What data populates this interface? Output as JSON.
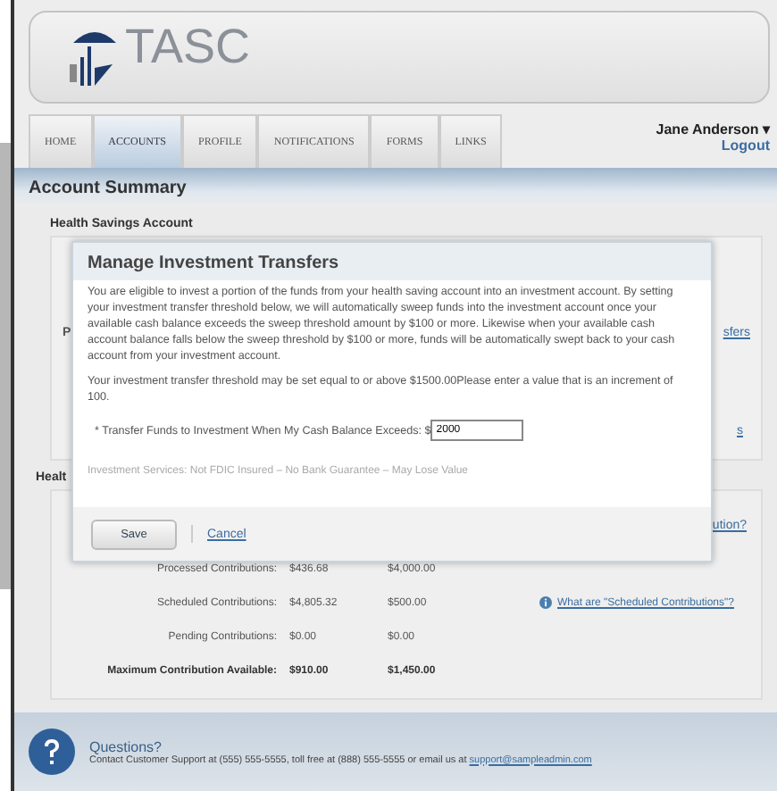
{
  "logo": {
    "text": "TASC"
  },
  "tabs": [
    {
      "label": "HOME",
      "selected": false
    },
    {
      "label": "ACCOUNTS",
      "selected": true
    },
    {
      "label": "PROFILE",
      "selected": false
    },
    {
      "label": "NOTIFICATIONS",
      "selected": false
    },
    {
      "label": "FORMS",
      "selected": false
    },
    {
      "label": "LINKS",
      "selected": false
    }
  ],
  "user": {
    "name": "Jane Anderson",
    "caret": "▾",
    "logout": "Logout"
  },
  "page_title": "Account Summary",
  "section_1": {
    "heading": "Health Savings Account",
    "row_label": "P",
    "link_1": "sfers",
    "link_2": "s"
  },
  "section_2": {
    "heading": "Healt",
    "link": "ution?",
    "rows": [
      {
        "label": "Processed Contributions:",
        "column_2": "$436.68",
        "column_3": "$4,000.00",
        "bold": false
      },
      {
        "label": "Scheduled Contributions:",
        "column_2": "$4,805.32",
        "column_3": "$500.00",
        "bold": false,
        "help_link": "What are \"Scheduled Contributions\"?"
      },
      {
        "label": "Pending Contributions:",
        "column_2": "$0.00",
        "column_3": "$0.00",
        "bold": false
      },
      {
        "label": "Maximum Contribution Available:",
        "column_2": "$910.00",
        "column_3": "$1,450.00",
        "bold": true
      }
    ]
  },
  "footer": {
    "title": "Questions?",
    "text": "Contact Customer Support at (555) 555-5555, toll free at (888) 555-5555 or email us at ",
    "email": "support@sampleadmin.com"
  },
  "modal": {
    "title": "Manage Investment Transfers",
    "paragraphs": [
      "You are eligible to invest a portion of the funds from your health saving account into an investment account. By setting your investment transfer threshold below, we will automatically sweep funds into the investment account once your available cash balance exceeds the sweep threshold amount by $100 or more. Likewise when your available cash account balance falls below the sweep threshold by $100 or more, funds will be automatically swept back to your cash account from your investment account.",
      "Your investment transfer threshold may be set equal to or above $1500.00Please enter a value that is an increment of 100."
    ],
    "field_label": "* Transfer Funds to Investment When My Cash Balance Exceeds: $",
    "field_value": "2000",
    "disclaimer": "Investment Services: Not FDIC Insured – No Bank Guarantee – May Lose Value",
    "save": "Save",
    "cancel": "Cancel"
  }
}
